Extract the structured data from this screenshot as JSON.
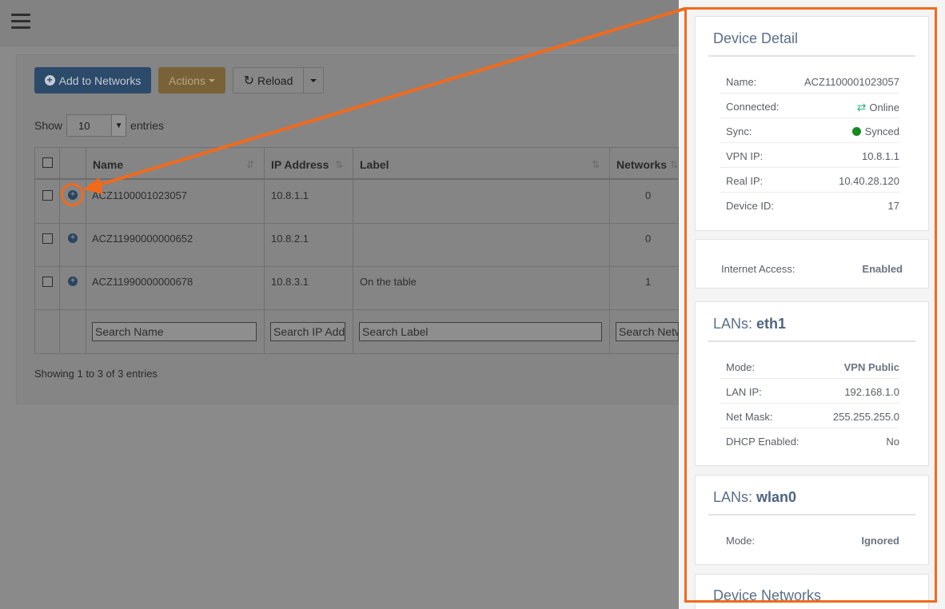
{
  "toolbar": {
    "add_label": "Add to Networks",
    "actions_label": "Actions",
    "reload_label": "Reload"
  },
  "length": {
    "prefix": "Show",
    "value": "10",
    "suffix": "entries"
  },
  "table": {
    "columns": [
      "Name",
      "IP Address",
      "Label",
      "Networks"
    ],
    "rows": [
      {
        "name": "ACZ1100001023057",
        "ip": "10.8.1.1",
        "label": "",
        "networks": "0"
      },
      {
        "name": "ACZ11990000000652",
        "ip": "10.8.2.1",
        "label": "",
        "networks": "0"
      },
      {
        "name": "ACZ11990000000678",
        "ip": "10.8.3.1",
        "label": "On the table",
        "networks": "1"
      }
    ],
    "search_placeholders": [
      "Search Name",
      "Search IP Address",
      "Search Label",
      "Search Networks"
    ],
    "info": "Showing 1 to 3 of 3 entries"
  },
  "detail": {
    "title": "Device Detail",
    "fields": [
      {
        "key": "Name:",
        "value": "ACZ1100001023057"
      },
      {
        "key": "Connected:",
        "value": "Online"
      },
      {
        "key": "Sync:",
        "value": "Synced"
      },
      {
        "key": "VPN IP:",
        "value": "10.8.1.1"
      },
      {
        "key": "Real IP:",
        "value": "10.40.28.120"
      },
      {
        "key": "Device ID:",
        "value": "17"
      }
    ],
    "status_colors": {
      "online": "#31b28a",
      "synced": "#138a1e"
    }
  },
  "internet": {
    "key": "Internet Access:",
    "value": "Enabled"
  },
  "lan_eth1": {
    "title_prefix": "LANs:",
    "iface": "eth1",
    "fields": [
      {
        "key": "Mode:",
        "value": "VPN Public"
      },
      {
        "key": "LAN IP:",
        "value": "192.168.1.0"
      },
      {
        "key": "Net Mask:",
        "value": "255.255.255.0"
      },
      {
        "key": "DHCP Enabled:",
        "value": "No"
      }
    ]
  },
  "lan_wlan0": {
    "title_prefix": "LANs:",
    "iface": "wlan0",
    "fields": [
      {
        "key": "Mode:",
        "value": "Ignored"
      }
    ]
  },
  "networks": {
    "title": "Device Networks"
  },
  "accent_color": "#f16a1c"
}
